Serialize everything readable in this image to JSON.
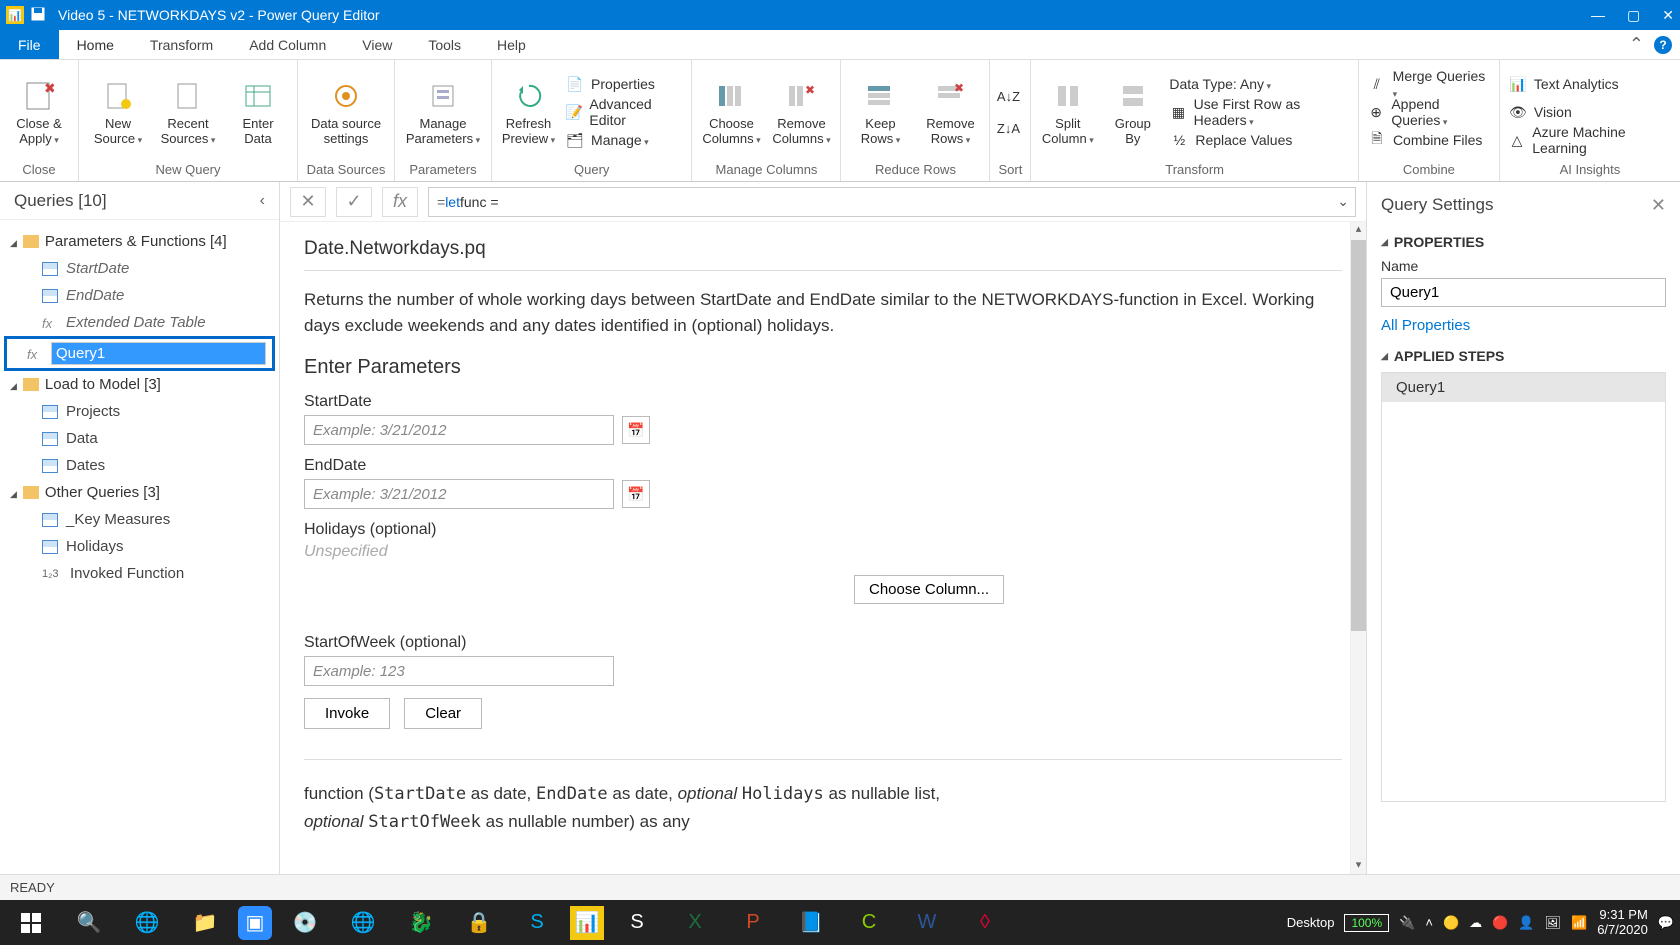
{
  "titlebar": {
    "title": "Video 5 - NETWORKDAYS v2 - Power Query Editor"
  },
  "menubar": {
    "file": "File",
    "tabs": [
      "Home",
      "Transform",
      "Add Column",
      "View",
      "Tools",
      "Help"
    ],
    "active": 0
  },
  "ribbon": {
    "close": {
      "close_apply": "Close &\nApply",
      "group": "Close"
    },
    "newquery": {
      "new_source": "New\nSource",
      "recent_sources": "Recent\nSources",
      "enter_data": "Enter\nData",
      "group": "New Query"
    },
    "datasources": {
      "data_source_settings": "Data source\nsettings",
      "group": "Data Sources"
    },
    "parameters": {
      "manage_parameters": "Manage\nParameters",
      "group": "Parameters"
    },
    "query": {
      "refresh_preview": "Refresh\nPreview",
      "properties": "Properties",
      "advanced_editor": "Advanced Editor",
      "manage": "Manage",
      "group": "Query"
    },
    "columns": {
      "choose_columns": "Choose\nColumns",
      "remove_columns": "Remove\nColumns",
      "group": "Manage Columns"
    },
    "rows": {
      "keep_rows": "Keep\nRows",
      "remove_rows": "Remove\nRows",
      "group": "Reduce Rows"
    },
    "sort": {
      "group": "Sort"
    },
    "transform": {
      "split_column": "Split\nColumn",
      "group_by": "Group\nBy",
      "data_type": "Data Type: Any",
      "first_row": "Use First Row as Headers",
      "replace": "Replace Values",
      "group": "Transform"
    },
    "combine": {
      "merge": "Merge Queries",
      "append": "Append Queries",
      "combine_files": "Combine Files",
      "group": "Combine"
    },
    "ai": {
      "text_analytics": "Text Analytics",
      "vision": "Vision",
      "ml": "Azure Machine Learning",
      "group": "AI Insights"
    }
  },
  "queries": {
    "header": "Queries [10]",
    "groups": [
      {
        "label": "Parameters & Functions [4]",
        "items": [
          {
            "kind": "table",
            "label": "StartDate",
            "italic": true
          },
          {
            "kind": "table",
            "label": "EndDate",
            "italic": true
          },
          {
            "kind": "fx",
            "label": "Extended Date Table",
            "italic": true
          },
          {
            "kind": "fx",
            "label": "Query1",
            "editing": true
          }
        ]
      },
      {
        "label": "Load to Model [3]",
        "items": [
          {
            "kind": "table",
            "label": "Projects"
          },
          {
            "kind": "table",
            "label": "Data"
          },
          {
            "kind": "table",
            "label": "Dates"
          }
        ]
      },
      {
        "label": "Other Queries [3]",
        "items": [
          {
            "kind": "table",
            "label": "_Key Measures"
          },
          {
            "kind": "table",
            "label": "Holidays"
          },
          {
            "kind": "123",
            "label": "Invoked Function"
          }
        ]
      }
    ]
  },
  "formula": {
    "prefix": "= ",
    "keyword": "let",
    "rest": "  func  ="
  },
  "func": {
    "title": "Date.Networkdays.pq",
    "desc": "Returns the number of whole working days between StartDate and EndDate similar to the NETWORKDAYS-function in Excel. Working days exclude weekends and any dates identified in (optional) holidays.",
    "enter_params": "Enter Parameters",
    "params": {
      "startdate_label": "StartDate",
      "startdate_ph": "Example: 3/21/2012",
      "enddate_label": "EndDate",
      "enddate_ph": "Example: 3/21/2012",
      "holidays_label": "Holidays (optional)",
      "unspecified": "Unspecified",
      "choose_column": "Choose Column...",
      "startofweek_label": "StartOfWeek (optional)",
      "startofweek_ph": "Example: 123"
    },
    "invoke": "Invoke",
    "clear": "Clear",
    "sig_prefix": "function (",
    "sig_p1": "StartDate",
    "sig_t1": " as date, ",
    "sig_p2": "EndDate",
    "sig_t2": " as date, ",
    "sig_opt": "optional",
    "sig_p3": "Holidays",
    "sig_t3": " as nullable list, ",
    "sig_p4": "StartOfWeek",
    "sig_t4": " as nullable number) as any"
  },
  "settings": {
    "header": "Query Settings",
    "properties": "PROPERTIES",
    "name_label": "Name",
    "name_value": "Query1",
    "all_properties": "All Properties",
    "applied_steps": "APPLIED STEPS",
    "steps": [
      "Query1"
    ]
  },
  "status": "READY",
  "taskbar": {
    "desktop": "Desktop",
    "battery": "100%",
    "time": "9:31 PM",
    "date": "6/7/2020"
  }
}
